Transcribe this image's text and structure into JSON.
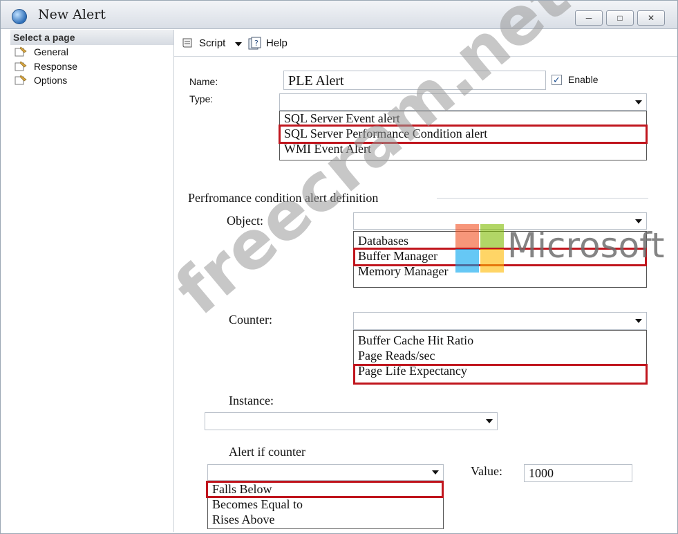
{
  "window": {
    "title": "New Alert"
  },
  "sidebar": {
    "header": "Select a page",
    "items": [
      {
        "label": "General"
      },
      {
        "label": "Response"
      },
      {
        "label": "Options"
      }
    ]
  },
  "toolbar": {
    "script_label": "Script",
    "help_label": "Help"
  },
  "form": {
    "name_label": "Name:",
    "name_value": "PLE Alert",
    "enable_label": "Enable",
    "enable_checked": true,
    "type_label": "Type:",
    "type_options": [
      "SQL Server Event alert",
      "SQL Server Performance Condition alert",
      "WMI Event Alert"
    ],
    "section_title": "Perfromance condition alert definition",
    "object_label": "Object:",
    "object_options": [
      "Databases",
      "Buffer Manager",
      "Memory Manager"
    ],
    "counter_label": "Counter:",
    "counter_options": [
      "Buffer Cache Hit Ratio",
      "Page Reads/sec",
      "Page Life Expectancy"
    ],
    "instance_label": "Instance:",
    "alert_if_label": "Alert if counter",
    "alert_if_options": [
      "Falls Below",
      "Becomes Equal to",
      "Rises Above"
    ],
    "value_label": "Value:",
    "value": "1000"
  },
  "overlay": {
    "microsoft_text": "Microsoft",
    "watermark": "freecram.net",
    "ms_colors": [
      "#f25022",
      "#7fba00",
      "#00a4ef",
      "#ffb900"
    ],
    "highlight_color": "#c0151d"
  }
}
